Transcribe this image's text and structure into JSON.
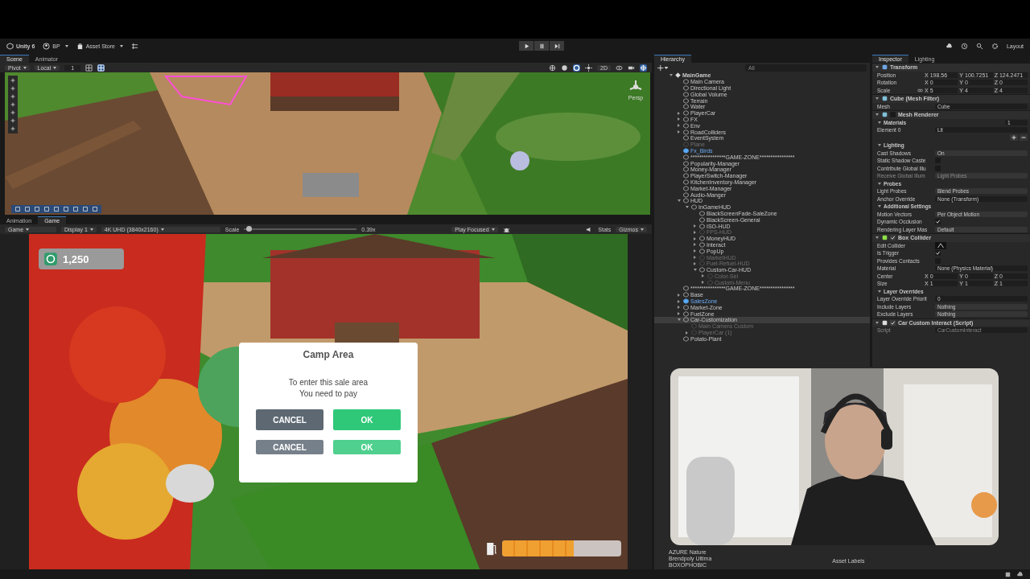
{
  "toolbar": {
    "app": "Unity 6",
    "account": "BP",
    "store": "Asset Store",
    "layout": "Layout"
  },
  "scene_panel": {
    "tabs": [
      {
        "label": "Scene",
        "selected": true
      },
      {
        "label": "Animator",
        "selected": false
      }
    ],
    "pivot": "Pivot",
    "space": "Local",
    "snap": "1",
    "mode_2d": "2D",
    "camera": "Persp"
  },
  "game_panel": {
    "tabs": [
      {
        "label": "Animation",
        "selected": false
      },
      {
        "label": "Game",
        "selected": true
      }
    ],
    "view": "Game",
    "display": "Display 1",
    "resolution": "4K UHD (3840x2160)",
    "scale_label": "Scale",
    "scale": {
      "level": 0.04,
      "reading": "0.39x"
    },
    "play_mode": "Play Focused",
    "stats": "Stats",
    "gizmos": "Gizmos"
  },
  "hud": {
    "money": "1,250",
    "dialog": {
      "title": "Camp Area",
      "lines": [
        "To enter this sale area",
        "You need to pay"
      ],
      "cancel": "CANCEL",
      "ok": "OK",
      "echo_cancel": "CANCEL",
      "echo_ok": "OK"
    },
    "fuel": {
      "level": 0.6
    }
  },
  "hierarchy": {
    "title": "Hierarchy",
    "search": {
      "placeholder": "All"
    },
    "tree": [
      {
        "name": "MainGame",
        "kind": "scene",
        "active": true,
        "selected": false,
        "expanded": true,
        "children": [
          {
            "name": "Main Camera",
            "kind": "object",
            "active": true,
            "selected": false
          },
          {
            "name": "Directional Light",
            "kind": "object",
            "active": true,
            "selected": false
          },
          {
            "name": "Global Volume",
            "kind": "object",
            "active": true,
            "selected": false
          },
          {
            "name": "Terrain",
            "kind": "object",
            "active": true,
            "selected": false
          },
          {
            "name": "Water",
            "kind": "object",
            "active": true,
            "selected": false
          },
          {
            "name": "PlayerCar",
            "kind": "object",
            "active": true,
            "selected": false,
            "expanded": false
          },
          {
            "name": "FX",
            "kind": "object",
            "active": true,
            "selected": false,
            "expanded": false
          },
          {
            "name": "Env",
            "kind": "object",
            "active": true,
            "selected": false,
            "expanded": false
          },
          {
            "name": "RoadColliders",
            "kind": "object",
            "active": true,
            "selected": false,
            "expanded": false
          },
          {
            "name": "EventSystem",
            "kind": "object",
            "active": true,
            "selected": false
          },
          {
            "name": "Plane",
            "kind": "object",
            "active": false,
            "selected": false
          },
          {
            "name": "Fx_Birds",
            "kind": "prefab",
            "active": true,
            "selected": false
          },
          {
            "name": "****************GAME-ZONE****************",
            "kind": "object",
            "active": true,
            "selected": false
          },
          {
            "name": "Popularity-Manager",
            "kind": "object",
            "active": true,
            "selected": false
          },
          {
            "name": "Money-Manager",
            "kind": "object",
            "active": true,
            "selected": false
          },
          {
            "name": "PlayerSwitch-Manager",
            "kind": "object",
            "active": true,
            "selected": false
          },
          {
            "name": "KitchenInventory-Manager",
            "kind": "object",
            "active": true,
            "selected": false
          },
          {
            "name": "Market-Manager",
            "kind": "object",
            "active": true,
            "selected": false
          },
          {
            "name": "Audio-Manger",
            "kind": "object",
            "active": true,
            "selected": false
          },
          {
            "name": "HUD",
            "kind": "object",
            "active": true,
            "selected": false,
            "expanded": true,
            "children": [
              {
                "name": "InGameHUD",
                "kind": "object",
                "active": true,
                "selected": false,
                "expanded": true,
                "children": [
                  {
                    "name": "BlackScreenFade-SaleZone",
                    "kind": "object",
                    "active": true,
                    "selected": false
                  },
                  {
                    "name": "BlackScreen-General",
                    "kind": "object",
                    "active": true,
                    "selected": false
                  },
                  {
                    "name": "ISO-HUD",
                    "kind": "object",
                    "active": true,
                    "selected": false,
                    "expanded": false
                  },
                  {
                    "name": "FPS-HUD",
                    "kind": "object",
                    "active": false,
                    "selected": false,
                    "expanded": false
                  },
                  {
                    "name": "MoneyHUD",
                    "kind": "object",
                    "active": true,
                    "selected": false,
                    "expanded": false
                  },
                  {
                    "name": "Interact",
                    "kind": "object",
                    "active": true,
                    "selected": false,
                    "expanded": false
                  },
                  {
                    "name": "PopUp",
                    "kind": "object",
                    "active": true,
                    "selected": false,
                    "expanded": false
                  },
                  {
                    "name": "MarketHUD",
                    "kind": "object",
                    "active": false,
                    "selected": false,
                    "expanded": false
                  },
                  {
                    "name": "Fuel-Refuel-HUD",
                    "kind": "object",
                    "active": false,
                    "selected": false,
                    "expanded": false
                  },
                  {
                    "name": "Custom-Car-HUD",
                    "kind": "object",
                    "active": true,
                    "selected": false,
                    "expanded": true,
                    "children": [
                      {
                        "name": "Color-Sel",
                        "kind": "object",
                        "active": false,
                        "selected": false,
                        "expanded": false
                      },
                      {
                        "name": "Custom-Menu",
                        "kind": "object",
                        "active": false,
                        "selected": false,
                        "expanded": false
                      }
                    ]
                  }
                ]
              }
            ]
          },
          {
            "name": "****************GAME-ZONE****************",
            "kind": "object",
            "active": true,
            "selected": false
          },
          {
            "name": "Base",
            "kind": "object",
            "active": true,
            "selected": false,
            "expanded": false
          },
          {
            "name": "SalesZone",
            "kind": "prefab",
            "active": true,
            "selected": false,
            "expanded": false
          },
          {
            "name": "Market-Zone",
            "kind": "object",
            "active": true,
            "selected": false,
            "expanded": false
          },
          {
            "name": "FuelZone",
            "kind": "object",
            "active": true,
            "selected": false,
            "expanded": false
          },
          {
            "name": "Car-Customization",
            "kind": "object",
            "active": true,
            "selected": true,
            "expanded": true,
            "children": [
              {
                "name": "Main Camera Custom",
                "kind": "object",
                "active": false,
                "selected": false
              },
              {
                "name": "PlayerCar (1)",
                "kind": "object",
                "active": false,
                "selected": false,
                "expanded": false
              }
            ]
          },
          {
            "name": "Potato-Plant",
            "kind": "object",
            "active": true,
            "selected": false
          }
        ]
      }
    ]
  },
  "inspector": {
    "tabs": [
      {
        "label": "Inspector",
        "selected": true
      },
      {
        "label": "Lighting",
        "selected": false
      }
    ],
    "components": [
      {
        "title": "Transform",
        "rows": [
          {
            "kind": "vec3",
            "label": "Position",
            "values": [
              {
                "axis": "X",
                "value": "198.56"
              },
              {
                "axis": "Y",
                "value": "100.7251"
              },
              {
                "axis": "Z",
                "value": "124.2471"
              }
            ]
          },
          {
            "kind": "vec3",
            "label": "Rotation",
            "values": [
              {
                "axis": "X",
                "value": "0"
              },
              {
                "axis": "Y",
                "value": "0"
              },
              {
                "axis": "Z",
                "value": "0"
              }
            ]
          },
          {
            "kind": "vec3",
            "label": "Scale",
            "link": true,
            "values": [
              {
                "axis": "X",
                "value": "5"
              },
              {
                "axis": "Y",
                "value": "4"
              },
              {
                "axis": "Z",
                "value": "4"
              }
            ]
          }
        ]
      },
      {
        "title": "Cube (Mesh Filter)",
        "rows": [
          {
            "kind": "object",
            "label": "Mesh",
            "value": "Cube",
            "disabled": false
          }
        ]
      },
      {
        "title": "Mesh Renderer",
        "enabled": false,
        "rows": [
          {
            "kind": "section",
            "label": "Materials",
            "value": "1"
          },
          {
            "kind": "object",
            "label": "Element 0",
            "value": "Lit",
            "disabled": false
          },
          {
            "kind": "addremove"
          },
          {
            "kind": "section",
            "label": "Lighting"
          },
          {
            "kind": "dropdown",
            "label": "Cast Shadows",
            "value": "On",
            "disabled": false
          },
          {
            "kind": "checkbox",
            "label": "Static Shadow Caste",
            "checked": false,
            "disabled": false
          },
          {
            "kind": "checkbox",
            "label": "Contribute Global Illu",
            "checked": false,
            "disabled": false
          },
          {
            "kind": "dropdown",
            "label": "Receive Global Illum",
            "value": "Light Probes",
            "disabled": true
          },
          {
            "kind": "section",
            "label": "Probes"
          },
          {
            "kind": "dropdown",
            "label": "Light Probes",
            "value": "Blend Probes",
            "disabled": false
          },
          {
            "kind": "object",
            "label": "Anchor Override",
            "value": "None (Transform)",
            "disabled": false
          },
          {
            "kind": "section",
            "label": "Additional Settings"
          },
          {
            "kind": "dropdown",
            "label": "Motion Vectors",
            "value": "Per Object Motion",
            "disabled": false
          },
          {
            "kind": "checkbox",
            "label": "Dynamic Occlusion",
            "checked": true,
            "disabled": false
          },
          {
            "kind": "dropdown",
            "label": "Rendering Layer Mas",
            "value": "Default",
            "disabled": false
          }
        ]
      },
      {
        "title": "Box Collider",
        "enabled": true,
        "rows": [
          {
            "kind": "edit",
            "label": "Edit Collider"
          },
          {
            "kind": "checkbox",
            "label": "Is Trigger",
            "checked": true,
            "disabled": false
          },
          {
            "kind": "checkbox",
            "label": "Provides Contacts",
            "checked": false,
            "disabled": false
          },
          {
            "kind": "object",
            "label": "Material",
            "value": "None (Physics Material)",
            "disabled": false
          },
          {
            "kind": "vec3",
            "label": "Center",
            "values": [
              {
                "axis": "X",
                "value": "0"
              },
              {
                "axis": "Y",
                "value": "0"
              },
              {
                "axis": "Z",
                "value": "0"
              }
            ]
          },
          {
            "kind": "vec3",
            "label": "Size",
            "values": [
              {
                "axis": "X",
                "value": "1"
              },
              {
                "axis": "Y",
                "value": "1"
              },
              {
                "axis": "Z",
                "value": "1"
              }
            ]
          },
          {
            "kind": "section",
            "label": "Layer Overrides"
          },
          {
            "kind": "number",
            "label": "Layer Override Priorit",
            "value": "0"
          },
          {
            "kind": "dropdown",
            "label": "Include Layers",
            "value": "Nothing",
            "disabled": false
          },
          {
            "kind": "dropdown",
            "label": "Exclude Layers",
            "value": "Nothing",
            "disabled": false
          }
        ]
      },
      {
        "title": "Car Custom Interact (Script)",
        "enabled": true,
        "rows": [
          {
            "kind": "object",
            "label": "Script",
            "value": "CarCustomInteract",
            "disabled": true
          }
        ]
      }
    ]
  },
  "project": {
    "folders": [
      "AZURE Nature",
      "Brendpoly Ultima",
      "BOXOPHOBIC"
    ],
    "labels": "Asset Labels"
  }
}
